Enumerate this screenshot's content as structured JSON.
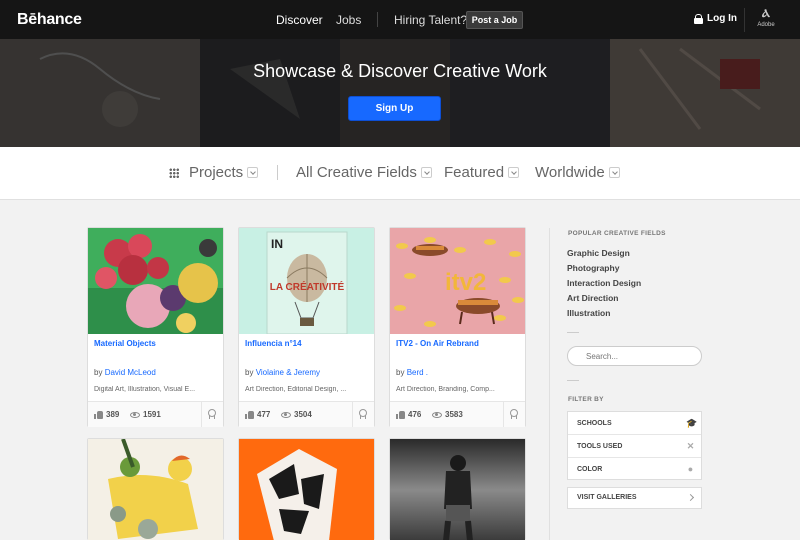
{
  "nav": {
    "logo": "Bēhance",
    "discover": "Discover",
    "jobs": "Jobs",
    "hiring": "Hiring Talent?",
    "post_job": "Post a Job",
    "login": "Log In",
    "adobe_label": "Adobe"
  },
  "hero": {
    "title": "Showcase & Discover Creative Work",
    "signup": "Sign Up"
  },
  "filters": {
    "projects": "Projects",
    "fields": "All Creative Fields",
    "featured": "Featured",
    "worldwide": "Worldwide"
  },
  "cards": [
    {
      "title": "Material Objects",
      "by": "by",
      "owner": "David McLeod",
      "fields": "Digital Art, Illustration, Visual E...",
      "appreciations": "389",
      "views": "1591"
    },
    {
      "title": "Influencia n°14",
      "by": "by",
      "owner": "Violaine & Jeremy",
      "fields": "Art Direction, Editorial Design, ...",
      "appreciations": "477",
      "views": "3504",
      "cover_text": "LA CRÉATIVITÉ"
    },
    {
      "title": "ITV2 - On Air Rebrand",
      "by": "by",
      "owner": "Berd .",
      "fields": "Art Direction, Branding, Comp...",
      "appreciations": "476",
      "views": "3583",
      "cover_text": "itv2"
    }
  ],
  "sidebar": {
    "popular_heading": "POPULAR CREATIVE FIELDS",
    "popular_fields": [
      "Graphic Design",
      "Photography",
      "Interaction Design",
      "Art Direction",
      "Illustration"
    ],
    "search_placeholder": "Search...",
    "filter_heading": "FILTER BY",
    "filter_items": [
      "SCHOOLS",
      "TOOLS USED",
      "COLOR"
    ],
    "visit": "VISIT GALLERIES"
  },
  "colors": {
    "accent": "#1769ff",
    "nav_bg": "#151515"
  }
}
